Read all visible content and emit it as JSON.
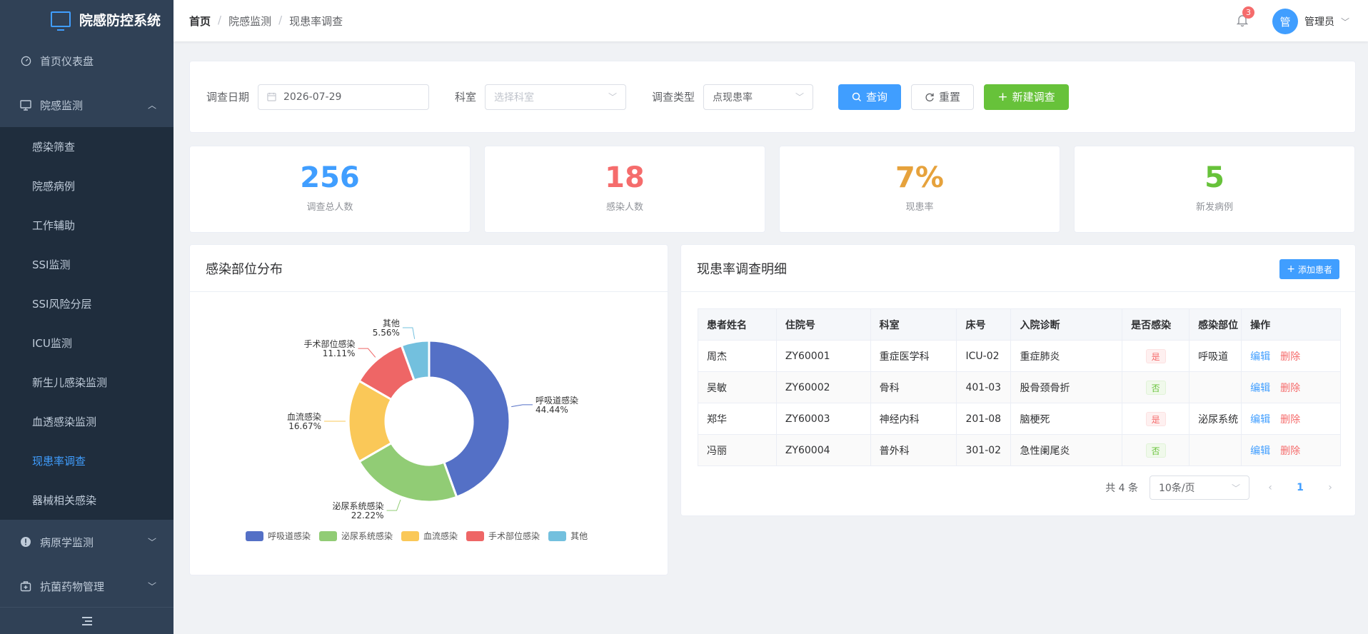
{
  "app": {
    "title": "院感防控系统"
  },
  "sidebar": {
    "items": [
      {
        "label": "首页仪表盘",
        "icon": "dashboard-icon"
      },
      {
        "label": "院感监测",
        "icon": "monitor-icon",
        "expanded": true
      },
      {
        "label": "病原学监测",
        "icon": "alert-icon"
      },
      {
        "label": "抗菌药物管理",
        "icon": "medkit-icon"
      }
    ],
    "sub_items": [
      "感染筛查",
      "院感病例",
      "工作辅助",
      "SSI监测",
      "SSI风险分层",
      "ICU监测",
      "新生儿感染监测",
      "血透感染监测",
      "现患率调查",
      "器械相关感染"
    ],
    "active": "现患率调查"
  },
  "header": {
    "breadcrumb": [
      "首页",
      "院感监测",
      "现患率调查"
    ],
    "notification_count": "3",
    "user_initial": "管",
    "user_name": "管理员"
  },
  "filter": {
    "date_label": "调查日期",
    "date_value": "2026-07-29",
    "dept_label": "科室",
    "dept_placeholder": "选择科室",
    "type_label": "调查类型",
    "type_value": "点现患率",
    "query_label": "查询",
    "reset_label": "重置",
    "new_label": "新建调查"
  },
  "stats": [
    {
      "value": "256",
      "label": "调查总人数",
      "color": "#409eff"
    },
    {
      "value": "18",
      "label": "感染人数",
      "color": "#f56c6c"
    },
    {
      "value": "7%",
      "label": "现患率",
      "color": "#e6a23c"
    },
    {
      "value": "5",
      "label": "新发病例",
      "color": "#67c23a"
    }
  ],
  "chart": {
    "title": "感染部位分布"
  },
  "chart_data": {
    "type": "pie",
    "donut": true,
    "categories": [
      "呼吸道感染",
      "泌尿系统感染",
      "血流感染",
      "手术部位感染",
      "其他"
    ],
    "values": [
      44.44,
      22.22,
      16.67,
      11.11,
      5.56
    ],
    "labels": [
      "44.44%",
      "22.22%",
      "16.67%",
      "11.11%",
      "5.56%"
    ],
    "colors": [
      "#5470c6",
      "#91cc75",
      "#fac858",
      "#ee6666",
      "#73c0de"
    ],
    "legend_position": "bottom"
  },
  "table": {
    "title": "现患率调查明细",
    "add_label": "添加患者",
    "columns": [
      "患者姓名",
      "住院号",
      "科室",
      "床号",
      "入院诊断",
      "是否感染",
      "感染部位",
      "操作"
    ],
    "rows": [
      {
        "name": "周杰",
        "id": "ZY60001",
        "dept": "重症医学科",
        "bed": "ICU-02",
        "diag": "重症肺炎",
        "infected": "是",
        "site": "呼吸道"
      },
      {
        "name": "吴敏",
        "id": "ZY60002",
        "dept": "骨科",
        "bed": "401-03",
        "diag": "股骨颈骨折",
        "infected": "否",
        "site": ""
      },
      {
        "name": "郑华",
        "id": "ZY60003",
        "dept": "神经内科",
        "bed": "201-08",
        "diag": "脑梗死",
        "infected": "是",
        "site": "泌尿系统"
      },
      {
        "name": "冯丽",
        "id": "ZY60004",
        "dept": "普外科",
        "bed": "301-02",
        "diag": "急性阑尾炎",
        "infected": "否",
        "site": ""
      }
    ],
    "edit_label": "编辑",
    "delete_label": "删除",
    "total_text": "共 4 条",
    "page_size": "10条/页",
    "current_page": "1"
  }
}
